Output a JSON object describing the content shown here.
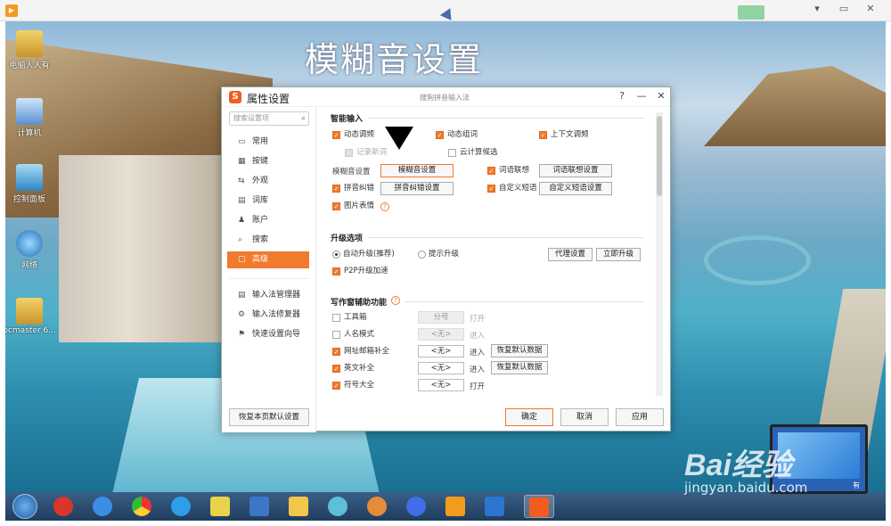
{
  "desktop": {
    "title_art": "模糊音设置",
    "icons": [
      {
        "label": "电脑人人有"
      },
      {
        "label": "计算机"
      },
      {
        "label": "控制面板"
      },
      {
        "label": "网络"
      },
      {
        "label": "pcmaster 6..."
      }
    ]
  },
  "player": {
    "min": "▾",
    "max": "▭",
    "close": "✕"
  },
  "dialog": {
    "title": "属性设置",
    "subtitle": "搜狗拼音输入法",
    "controls": {
      "help": "?",
      "min": "—",
      "close": "✕"
    },
    "search_placeholder": "搜索设置项",
    "nav": [
      {
        "label": "常用",
        "icon": "▭"
      },
      {
        "label": "按键",
        "icon": "▦"
      },
      {
        "label": "外观",
        "icon": "⇆"
      },
      {
        "label": "词库",
        "icon": "▤"
      },
      {
        "label": "账户",
        "icon": "♟"
      },
      {
        "label": "搜索",
        "icon": "⌕"
      },
      {
        "label": "高级",
        "icon": "▢"
      }
    ],
    "tools": [
      {
        "label": "输入法管理器",
        "icon": "▤"
      },
      {
        "label": "输入法修复器",
        "icon": "⚙"
      },
      {
        "label": "快速设置向导",
        "icon": "⚑"
      }
    ],
    "restore_page": "恢复本页默认设置",
    "smart": {
      "title": "智能输入",
      "dynamic_freq": "动态调频",
      "dynamic_group": "动态组词",
      "context_freq": "上下文调频",
      "record_new": "记录新词",
      "cloud_candidate": "云计算候选",
      "fuzzy_label": "模糊音设置",
      "fuzzy_btn": "模糊音设置",
      "word_assoc": "词语联想",
      "word_assoc_btn": "词语联想设置",
      "pinyin_correct": "拼音纠错",
      "pinyin_correct_btn": "拼音纠错设置",
      "custom_phrase": "自定义短语",
      "custom_phrase_btn": "自定义短语设置",
      "emoji": "图片表情"
    },
    "upgrade": {
      "title": "升级选项",
      "auto": "自动升级(推荐)",
      "prompt": "提示升级",
      "proxy_btn": "代理设置",
      "now_btn": "立即升级",
      "p2p": "P2P升级加速"
    },
    "writing": {
      "title": "写作窗辅助功能",
      "rows": [
        {
          "label": "工具箱",
          "field": "分号",
          "action": "打开",
          "btn": ""
        },
        {
          "label": "人名模式",
          "field": "<无>",
          "action": "进入",
          "btn": ""
        },
        {
          "label": "网址邮箱补全",
          "field": "<无>",
          "action": "进入",
          "btn": "恢复默认数据"
        },
        {
          "label": "英文补全",
          "field": "<无>",
          "action": "进入",
          "btn": "恢复默认数据"
        },
        {
          "label": "符号大全",
          "field": "<无>",
          "action": "打开",
          "btn": ""
        }
      ]
    },
    "footer": {
      "ok": "确定",
      "cancel": "取消",
      "apply": "应用"
    }
  },
  "watermark": {
    "logo": "Bai经验",
    "url": "jingyan.baidu.com",
    "monitor_label": "有"
  }
}
